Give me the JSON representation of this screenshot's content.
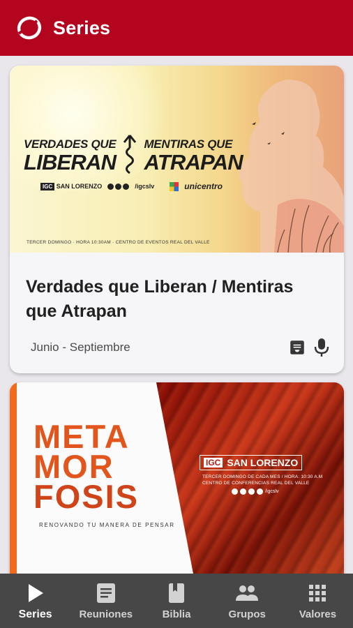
{
  "app": {
    "title": "Series",
    "brand_color": "#b4051e",
    "logo_icon": "church-logo-icon"
  },
  "series": [
    {
      "banner": {
        "line1_left": "VERDADES QUE",
        "line2_left": "LIBERAN",
        "line1_right": "MENTIRAS QUE",
        "line2_right": "ATRAPAN",
        "brand": "IGC SAN LORENZO",
        "brand_igc": "IGC",
        "brand_name": "SAN LORENZO",
        "social": "/igcslv",
        "sponsor": "unicentro",
        "footer": "TERCER DOMINGO  ·  HORA 10:30AM  ·  CENTRO DE EVENTOS REAL DEL VALLE"
      },
      "title": "Verdades que Liberan / Mentiras que Atrapan",
      "date": "Junio - Septiembre",
      "icons": [
        "archive-icon",
        "microphone-icon"
      ]
    },
    {
      "banner": {
        "meta_lines": [
          "META",
          "MOR",
          "FOSIS"
        ],
        "subtitle": "RENOVANDO TU MANERA DE PENSAR",
        "brand_igc": "IGC",
        "brand_name": "SAN LORENZO",
        "info_line1": "TERCER DOMINGO DE CADA MES  /  HORA: 10:30 A.M",
        "info_line2": "CENTRO DE CONFERENCIAS REAL DEL VALLE",
        "social": "/igcslv"
      }
    }
  ],
  "bottom_nav": [
    {
      "label": "Series",
      "icon": "play-icon",
      "active": true
    },
    {
      "label": "Reuniones",
      "icon": "list-icon",
      "active": false
    },
    {
      "label": "Biblia",
      "icon": "book-icon",
      "active": false
    },
    {
      "label": "Grupos",
      "icon": "people-icon",
      "active": false
    },
    {
      "label": "Valores",
      "icon": "apps-grid-icon",
      "active": false
    }
  ]
}
